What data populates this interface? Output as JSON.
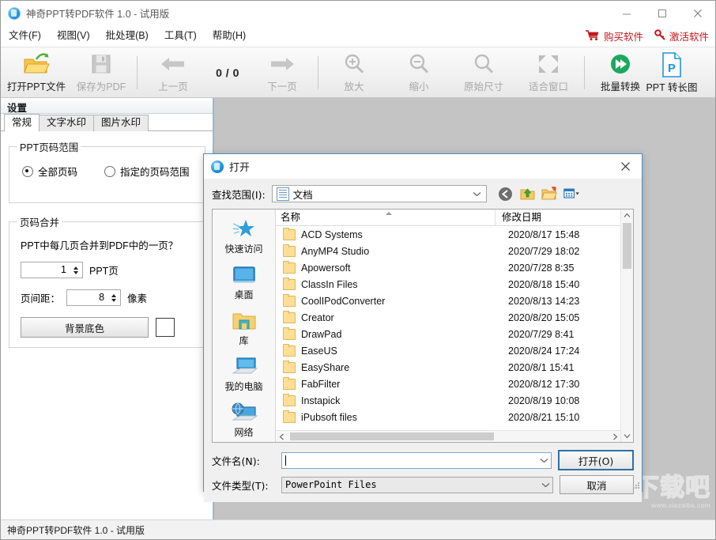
{
  "window": {
    "title": "神奇PPT转PDF软件 1.0 - 试用版",
    "minimize": "—",
    "maximize": "□",
    "close": "✕"
  },
  "menubar": {
    "items": [
      {
        "label": "文件(F)"
      },
      {
        "label": "视图(V)"
      },
      {
        "label": "批处理(B)"
      },
      {
        "label": "工具(T)"
      },
      {
        "label": "帮助(H)"
      }
    ],
    "buy_label": "购买软件",
    "activate_label": "激活软件",
    "accent_color": "#c4161c"
  },
  "toolbar": {
    "open_ppt": "打开PPT文件",
    "save_pdf": "保存为PDF",
    "prev_page": "上一页",
    "page_count": "0 / 0",
    "next_page": "下一页",
    "zoom_in": "放大",
    "zoom_out": "缩小",
    "actual_size": "原始尺寸",
    "fit_window": "适合窗口",
    "batch_convert": "批量转换",
    "ppt_to_long_image": "PPT 转长图"
  },
  "settings": {
    "header": "设置",
    "tabs": [
      {
        "label": "常规",
        "active": true
      },
      {
        "label": "文字水印",
        "active": false
      },
      {
        "label": "图片水印",
        "active": false
      }
    ],
    "page_range": {
      "legend": "PPT页码范围",
      "all_pages": "全部页码",
      "specified_pages": "指定的页码范围",
      "selected": "全部页码"
    },
    "merge": {
      "legend": "页码合并",
      "question": "PPT中每几页合并到PDF中的一页？",
      "pages_value": "1",
      "pages_unit": "PPT页",
      "gap_label": "页间距：",
      "gap_value": "8",
      "gap_unit": "像素",
      "bg_color_button": "背景底色",
      "bg_color_value": "#ffffff"
    }
  },
  "dialog": {
    "title": "打开",
    "look_in_label": "查找范围(I):",
    "look_in_value": "文档",
    "nav_icons": [
      "back-icon",
      "up-folder-icon",
      "new-folder-icon",
      "views-icon"
    ],
    "places": [
      {
        "label": "快速访问",
        "icon": "star-icon"
      },
      {
        "label": "桌面",
        "icon": "desktop-icon"
      },
      {
        "label": "库",
        "icon": "library-icon"
      },
      {
        "label": "我的电脑",
        "icon": "computer-icon"
      },
      {
        "label": "网络",
        "icon": "network-icon"
      }
    ],
    "columns": {
      "name": "名称",
      "date": "修改日期"
    },
    "files": [
      {
        "name": "ACD Systems",
        "date": "2020/8/17 15:48"
      },
      {
        "name": "AnyMP4 Studio",
        "date": "2020/7/29 18:02"
      },
      {
        "name": "Apowersoft",
        "date": "2020/7/28 8:35"
      },
      {
        "name": "ClassIn Files",
        "date": "2020/8/18 15:40"
      },
      {
        "name": "CoolIPodConverter",
        "date": "2020/8/13 14:23"
      },
      {
        "name": "Creator",
        "date": "2020/8/20 15:05"
      },
      {
        "name": "DrawPad",
        "date": "2020/7/29 8:41"
      },
      {
        "name": "EaseUS",
        "date": "2020/8/24 17:24"
      },
      {
        "name": "EasyShare",
        "date": "2020/8/1 15:41"
      },
      {
        "name": "FabFilter",
        "date": "2020/8/12 17:30"
      },
      {
        "name": "Instapick",
        "date": "2020/8/19 10:08"
      },
      {
        "name": "iPubsoft files",
        "date": "2020/8/21 15:10"
      }
    ],
    "filename_label": "文件名(N):",
    "filename_value": "",
    "filetype_label": "文件类型(T):",
    "filetype_value": "PowerPoint Files",
    "open_button": "打开(O)",
    "cancel_button": "取消"
  },
  "statusbar": {
    "text": "神奇PPT转PDF软件 1.0 - 试用版"
  },
  "watermark": {
    "text": "下载吧",
    "url": "www.xiazaiba.com"
  }
}
